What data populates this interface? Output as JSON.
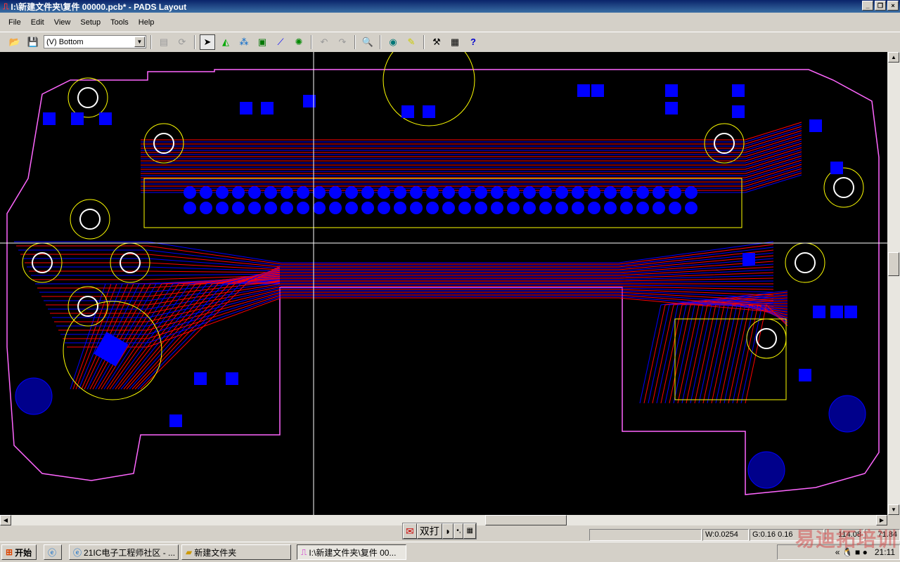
{
  "window": {
    "title": "I:\\新建文件夹\\复件 00000.pcb* - PADS Layout",
    "controls": [
      "_",
      "❐",
      "×"
    ]
  },
  "menu": [
    "File",
    "Edit",
    "View",
    "Setup",
    "Tools",
    "Help"
  ],
  "toolbar": {
    "layer_select": "(V) Bottom",
    "icons": [
      "open-icon",
      "save-icon",
      "layer-dropdown",
      "properties-icon",
      "redraw-icon",
      "select-icon",
      "drafting-icon",
      "design-icon",
      "ecm-icon",
      "route-icon",
      "bga-icon",
      "undo-icon",
      "redo-icon",
      "zoom-icon",
      "view-icon",
      "paint-icon",
      "edit-icon",
      "window-icon",
      "help-icon"
    ]
  },
  "ime": {
    "mode": "双打"
  },
  "status": {
    "width": "W:0.0254",
    "grid": "G:0.16 0.16",
    "x": "114.08",
    "y": "71.84"
  },
  "taskbar": {
    "start": "开始",
    "tasks": [
      "21IC电子工程师社区 - ...",
      "新建文件夹",
      "I:\\新建文件夹\\复件 00..."
    ],
    "clock": "21:11"
  },
  "watermark": "易迪拓培训",
  "colors": {
    "trace_top": "#ff0000",
    "trace_bottom": "#0000ff",
    "outline": "#ff66ff",
    "silkscreen": "#ffff00",
    "background": "#000000"
  }
}
